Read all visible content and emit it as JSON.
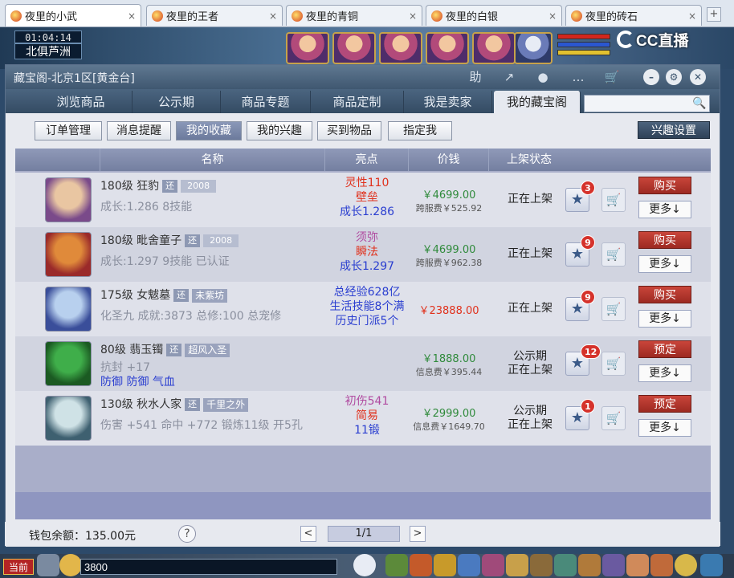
{
  "browser_tabs": [
    {
      "label": "夜里的小武",
      "active": true
    },
    {
      "label": "夜里的王者",
      "active": false
    },
    {
      "label": "夜里的青铜",
      "active": false
    },
    {
      "label": "夜里的白银",
      "active": false
    },
    {
      "label": "夜里的砖石",
      "active": false
    }
  ],
  "browser": {
    "close_glyph": "×",
    "new_tab_glyph": "+"
  },
  "game_hud": {
    "time": "01:04:14",
    "location": "北俱芦洲",
    "stream_logo": "CC直播"
  },
  "window": {
    "title": "藏宝阁-北京1区[黄金台]",
    "toolbar": {
      "help_icon": "助",
      "share_icon": "↗",
      "record_icon": "●",
      "chat_icon": "…",
      "cart_icon": "🛒"
    },
    "controls": {
      "minimize": "–",
      "settings": "⚙",
      "close": "✕"
    }
  },
  "nav_tabs": [
    {
      "label": "浏览商品",
      "active": false
    },
    {
      "label": "公示期",
      "active": false
    },
    {
      "label": "商品专题",
      "active": false
    },
    {
      "label": "商品定制",
      "active": false
    },
    {
      "label": "我是卖家",
      "active": false
    },
    {
      "label": "我的藏宝阁",
      "active": true
    }
  ],
  "search": {
    "placeholder": "",
    "icon": "🔍"
  },
  "sub_tabs": [
    {
      "label": "订单管理",
      "active": false
    },
    {
      "label": "消息提醒",
      "active": false
    },
    {
      "label": "我的收藏",
      "active": true
    },
    {
      "label": "我的兴趣",
      "active": false
    },
    {
      "label": "买到物品",
      "active": false
    },
    {
      "label": "指定我",
      "active": false
    }
  ],
  "interest_settings_label": "兴趣设置",
  "table": {
    "headers": {
      "name": "名称",
      "highlights": "亮点",
      "price": "价钱",
      "status": "上架状态"
    },
    "rows": [
      {
        "level_name": "180级  狂豹",
        "tag": "还",
        "tag_extra": "2008",
        "stats": "成长:1.286  8技能",
        "highlights": [
          {
            "text": "灵性110",
            "color": "#e0311c"
          },
          {
            "text": "壁垒",
            "color": "#e0311c"
          },
          {
            "text": "成长1.286",
            "color": "#2a3ed0"
          }
        ],
        "price": "￥4699.00",
        "fee": "跨服费￥525.92",
        "status": [
          "正在上架"
        ],
        "fav_count": "3",
        "action": "购买",
        "more": "更多↓",
        "thumb_colors": [
          "#e9c6a2",
          "#7a4a8a"
        ]
      },
      {
        "level_name": "180级  毗舍童子",
        "tag": "还",
        "tag_extra": "2008",
        "stats": "成长:1.297  9技能  已认证",
        "highlights": [
          {
            "text": "须弥",
            "color": "#b04aa0"
          },
          {
            "text": "瞬法",
            "color": "#e0311c"
          },
          {
            "text": "成长1.297",
            "color": "#2a3ed0"
          }
        ],
        "price": "￥4699.00",
        "fee": "跨服费￥962.38",
        "status": [
          "正在上架"
        ],
        "fav_count": "9",
        "action": "购买",
        "more": "更多↓",
        "thumb_colors": [
          "#e08a3a",
          "#9a2a2a"
        ]
      },
      {
        "level_name": "175级  女魃墓",
        "tag": "还",
        "tag_extra": "未紫坊",
        "stats": "化圣九  成就:3873  总修:100  总宠修",
        "highlights": [
          {
            "text": "总经验628亿",
            "color": "#2a3ed0"
          },
          {
            "text": "生活技能8个满",
            "color": "#2a3ed0"
          },
          {
            "text": "历史门派5个",
            "color": "#2a3ed0"
          }
        ],
        "price": "￥23888.00",
        "fee": "",
        "price_red": true,
        "status": [
          "正在上架"
        ],
        "fav_count": "9",
        "action": "购买",
        "more": "更多↓",
        "thumb_colors": [
          "#b8d0ee",
          "#3a4e9a"
        ]
      },
      {
        "level_name": "80级  翡玉镯",
        "tag": "还",
        "tag_extra": "超风入圣",
        "stats_lines": [
          {
            "text": "抗封  +17",
            "color": "#8a8f9e"
          },
          {
            "text": "防御  防御  气血",
            "color": "#2a3ed0"
          }
        ],
        "highlights": [],
        "price": "￥1888.00",
        "fee": "信息费￥395.44",
        "status": [
          "公示期",
          "正在上架"
        ],
        "fav_count": "12",
        "action": "预定",
        "more": "更多↓",
        "thumb_colors": [
          "#3fae4a",
          "#1b5a22"
        ]
      },
      {
        "level_name": "130级  秋水人家",
        "tag": "还",
        "tag_extra": "千里之外",
        "stats": "伤害  +541  命中  +772  锻炼11级  开5孔",
        "highlights": [
          {
            "text": "初伤541",
            "color": "#b04aa0"
          },
          {
            "text": "简易",
            "color": "#e0311c"
          },
          {
            "text": "11锻",
            "color": "#2a3ed0"
          }
        ],
        "price": "￥2999.00",
        "fee": "信息费￥1649.70",
        "status": [
          "公示期",
          "正在上架"
        ],
        "fav_count": "1",
        "action": "预定",
        "more": "更多↓",
        "thumb_colors": [
          "#cfe2e6",
          "#3e6070"
        ]
      }
    ]
  },
  "footer": {
    "wallet": "钱包余额：135.00元",
    "help": "?",
    "prev": "<",
    "page": "1/1",
    "next": ">"
  },
  "game_bottom": {
    "now_label": "当前",
    "chat_value": "3800"
  }
}
